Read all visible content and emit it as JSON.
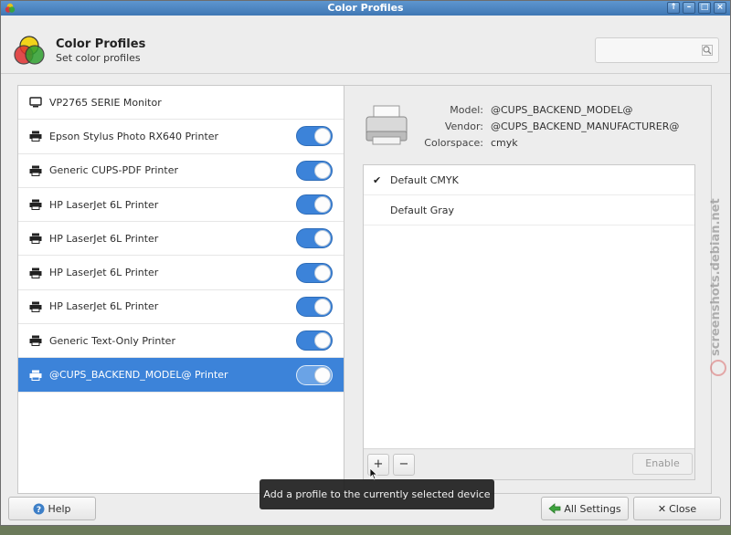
{
  "window": {
    "title": "Color Profiles"
  },
  "header": {
    "title": "Color Profiles",
    "subtitle": "Set color profiles"
  },
  "search": {
    "placeholder": ""
  },
  "devices": [
    {
      "label": "VP2765 SERIE Monitor",
      "icon": "monitor-icon",
      "toggle": null,
      "selected": false
    },
    {
      "label": "Epson Stylus Photo RX640 Printer",
      "icon": "printer-icon",
      "toggle": true,
      "selected": false
    },
    {
      "label": "Generic CUPS-PDF Printer",
      "icon": "printer-icon",
      "toggle": true,
      "selected": false
    },
    {
      "label": "HP LaserJet 6L Printer",
      "icon": "printer-icon",
      "toggle": true,
      "selected": false
    },
    {
      "label": "HP LaserJet 6L Printer",
      "icon": "printer-icon",
      "toggle": true,
      "selected": false
    },
    {
      "label": "HP LaserJet 6L Printer",
      "icon": "printer-icon",
      "toggle": true,
      "selected": false
    },
    {
      "label": "HP LaserJet 6L Printer",
      "icon": "printer-icon",
      "toggle": true,
      "selected": false
    },
    {
      "label": "Generic Text-Only Printer",
      "icon": "printer-icon",
      "toggle": true,
      "selected": false
    },
    {
      "label": "@CUPS_BACKEND_MODEL@ Printer",
      "icon": "printer-icon",
      "toggle": true,
      "selected": true
    }
  ],
  "details": {
    "model_label": "Model:",
    "model_value": "@CUPS_BACKEND_MODEL@",
    "vendor_label": "Vendor:",
    "vendor_value": "@CUPS_BACKEND_MANUFACTURER@",
    "colorspace_label": "Colorspace:",
    "colorspace_value": "cmyk"
  },
  "profiles": [
    {
      "name": "Default CMYK",
      "checked": true,
      "check_mark": "✔"
    },
    {
      "name": "Default Gray",
      "checked": false,
      "check_mark": ""
    }
  ],
  "profile_toolbar": {
    "add_label": "+",
    "remove_label": "−",
    "enable_label": "Enable"
  },
  "footer": {
    "help_label": "Help",
    "all_settings_label": "All Settings",
    "close_label": "Close"
  },
  "tooltip": {
    "text": "Add a profile to the currently selected device"
  },
  "watermark": {
    "text": "screenshots.debian.net"
  },
  "colors": {
    "accent": "#3c83d9",
    "titlebar": "#4a82c0"
  }
}
